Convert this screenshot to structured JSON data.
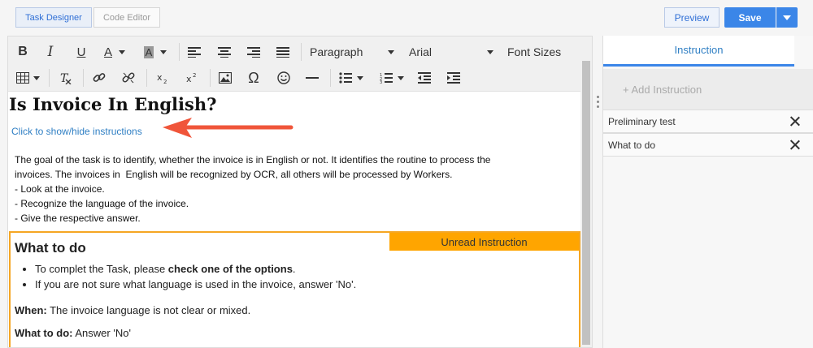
{
  "topbar": {
    "tab_task_designer": "Task Designer",
    "tab_code_editor": "Code Editor",
    "preview_label": "Preview",
    "save_label": "Save"
  },
  "toolbar": {
    "bold": "B",
    "italic": "I",
    "underline": "U",
    "font_color": "A",
    "bg_color": "A",
    "block_format": "Paragraph",
    "font_family": "Arial",
    "font_sizes": "Font Sizes",
    "special_char": "Ω"
  },
  "content": {
    "title": "Is Invoice In English?",
    "toggle_link": "Click to show/hide instructions",
    "description_lines": [
      "The goal of the task is to identify, whether the invoice is in English or not. It identifies the routine to process the",
      "invoices. The invoices in  English will be recognized by OCR, all others will be processed by Workers.",
      "- Look at the invoice.",
      "- Recognize the language of the invoice.",
      "- Give the respective answer."
    ]
  },
  "instruction_box": {
    "badge": "Unread Instruction",
    "heading": "What to do",
    "bullet1_prefix": "To complet the Task, please ",
    "bullet1_bold": "check one of the options",
    "bullet1_suffix": ".",
    "bullet2": "If you are not sure what language is used in the invoice, answer 'No'.",
    "when_label": "When:",
    "when_text": " The invoice language is not clear or mixed.",
    "what_label": "What to do:",
    "what_text": " Answer 'No'"
  },
  "right_panel": {
    "header": "Instruction",
    "add_label": "+ Add Instruction",
    "items": [
      {
        "label": "Preliminary test"
      },
      {
        "label": "What to do"
      }
    ]
  },
  "colors": {
    "accent": "#3b86e8",
    "link": "#2f7fc4",
    "badge": "#ffa500",
    "arrow": "#f0553a"
  }
}
